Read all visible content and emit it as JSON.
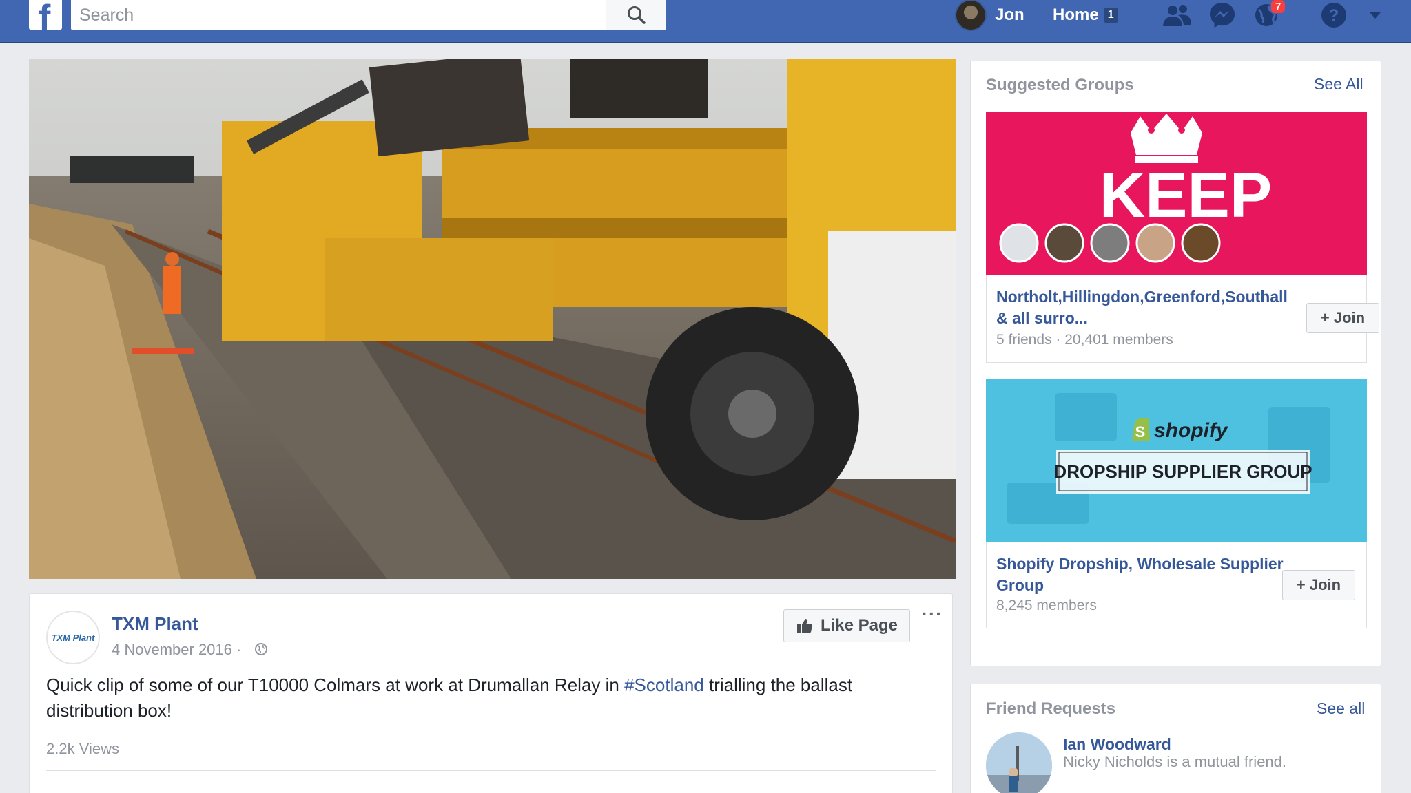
{
  "topbar": {
    "logo_letter": "f",
    "search_placeholder": "Search",
    "user_name": "Jon",
    "home_label": "Home",
    "home_count": "1",
    "notifications_count": "7"
  },
  "post": {
    "page_name": "TXM Plant",
    "avatar_text": "TXM Plant",
    "date": "4 November 2016",
    "date_separator": "·",
    "like_page_label": "Like Page",
    "more_label": "···",
    "text_before": "Quick clip of some of our T10000 Colmars at work at Drumallan Relay in ",
    "hashtag": "#Scotland",
    "text_after": " trialling the ballast distribution box!",
    "views": "2.2k Views"
  },
  "suggested_groups": {
    "title": "Suggested Groups",
    "see_all": "See All",
    "groups": [
      {
        "name": "Northolt,Hillingdon,Greenford,Southall & all surro...",
        "meta": "5 friends · 20,401 members",
        "join_label": "+ Join",
        "banner_text": "KEEP"
      },
      {
        "name": "Shopify Dropship, Wholesale Supplier Group",
        "meta": "8,245 members",
        "join_label": "+ Join",
        "banner_brand": "shopify",
        "banner_text": "DROPSHIP SUPPLIER GROUP"
      }
    ]
  },
  "friend_requests": {
    "title": "Friend Requests",
    "see_all": "See all",
    "items": [
      {
        "name": "Ian Woodward",
        "meta": "Nicky Nicholds is a mutual friend."
      }
    ]
  },
  "colors": {
    "brand_blue": "#4267b2",
    "link_blue": "#365899",
    "keep_calm_pink": "#e8175d",
    "shopify_teal": "#4fc1e0"
  }
}
